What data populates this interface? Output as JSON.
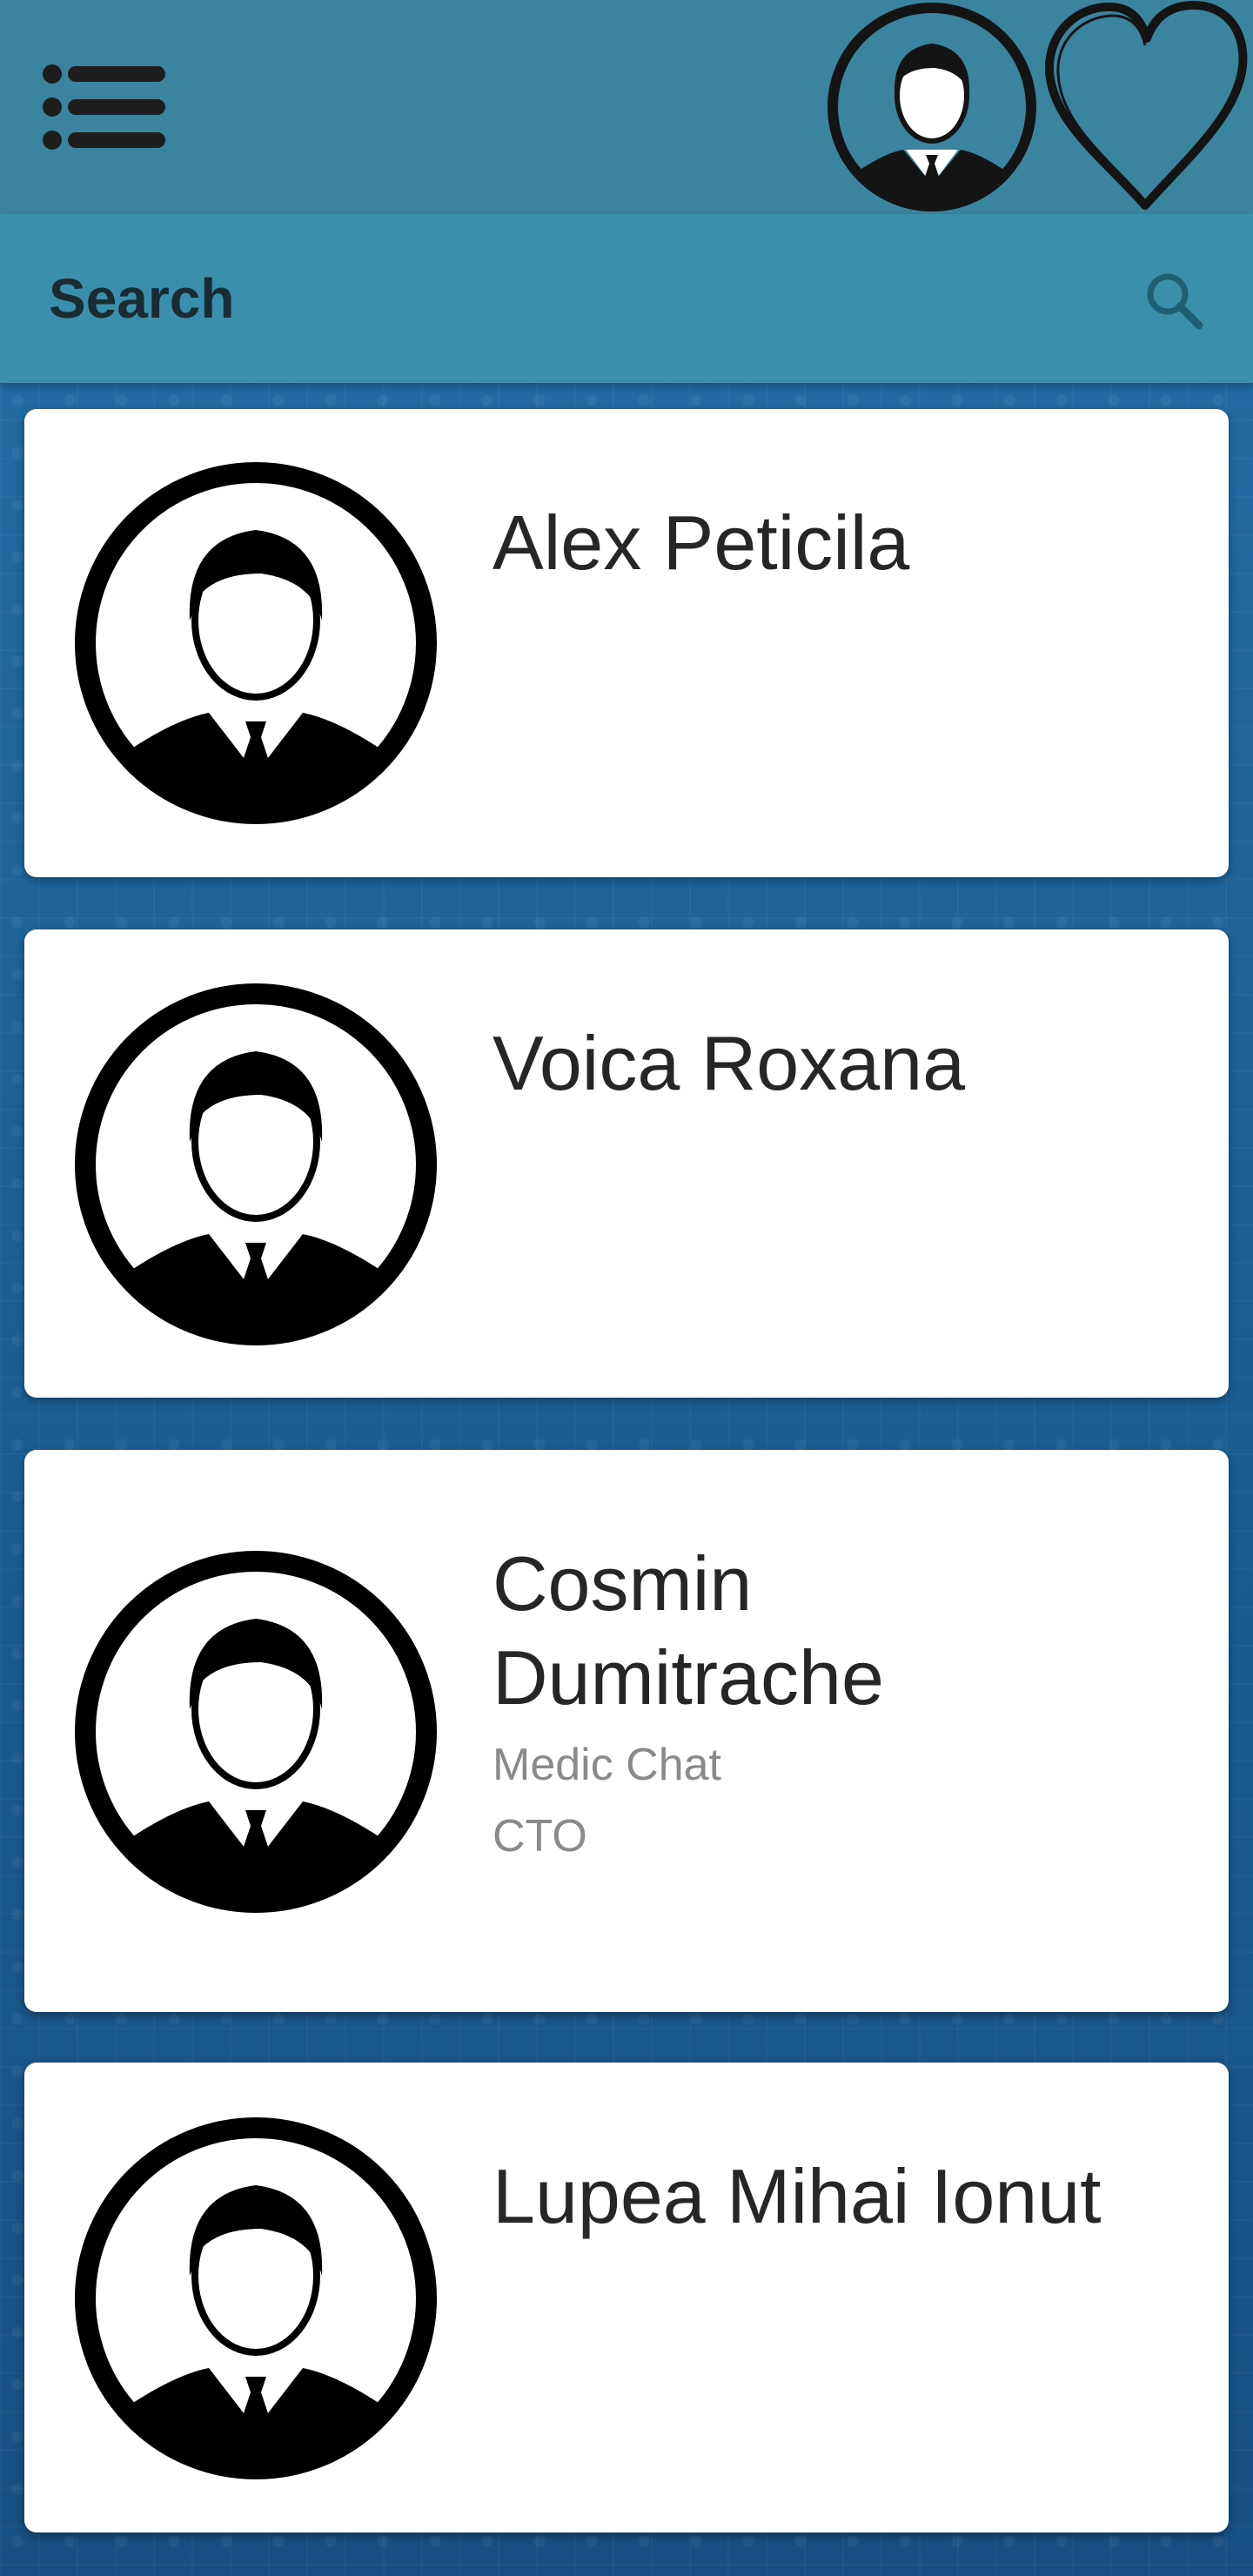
{
  "app_bar": {
    "menu_icon": "menu-list-icon",
    "profile_icon": "user-avatar-icon",
    "favorites_icon": "heart-outline-icon",
    "color": "#3b849f"
  },
  "search": {
    "placeholder": "Search",
    "icon": "search-icon",
    "color": "#3a8fad"
  },
  "contacts": [
    {
      "name": "Alex Peticila"
    },
    {
      "name": "Voica Roxana"
    },
    {
      "name": "Cosmin Dumitrache",
      "company": "Medic Chat",
      "role": "CTO"
    },
    {
      "name": "Lupea Mihai Ionut"
    }
  ]
}
